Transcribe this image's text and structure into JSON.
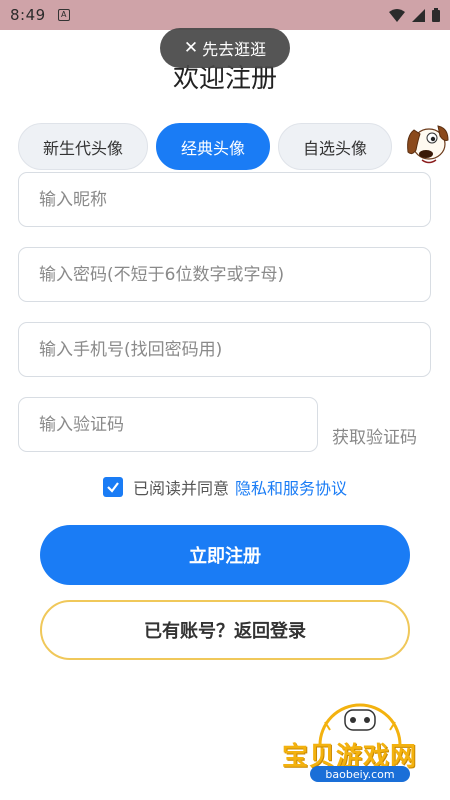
{
  "status_bar": {
    "time": "8:49",
    "notif_icon": "a-icon",
    "icons": [
      "wifi-icon",
      "signal-icon",
      "battery-icon"
    ]
  },
  "skip": {
    "label": "先去逛逛",
    "icon": "close-icon"
  },
  "page": {
    "title": "欢迎注册"
  },
  "avatar_tabs": [
    {
      "label": "新生代头像",
      "selected": false
    },
    {
      "label": "经典头像",
      "selected": true
    },
    {
      "label": "自选头像",
      "selected": false
    }
  ],
  "avatar_preview": {
    "icon": "dog-avatar-icon"
  },
  "form": {
    "nickname_placeholder": "输入昵称",
    "password_placeholder": "输入密码(不短于6位数字或字母)",
    "phone_placeholder": "输入手机号(找回密码用)",
    "code_placeholder": "输入验证码",
    "get_code_label": "获取验证码"
  },
  "agreement": {
    "checked": true,
    "text": "已阅读并同意",
    "link": "隐私和服务协议"
  },
  "buttons": {
    "register": "立即注册",
    "back_login": "已有账号？返回登录"
  },
  "watermark": {
    "text": "宝贝游戏网",
    "url": "baobeiy.com"
  },
  "colors": {
    "accent": "#1a7cf5",
    "status_bar": "#cfa3a8",
    "login_border": "#f0c85a",
    "watermark": "#f3b20f"
  }
}
